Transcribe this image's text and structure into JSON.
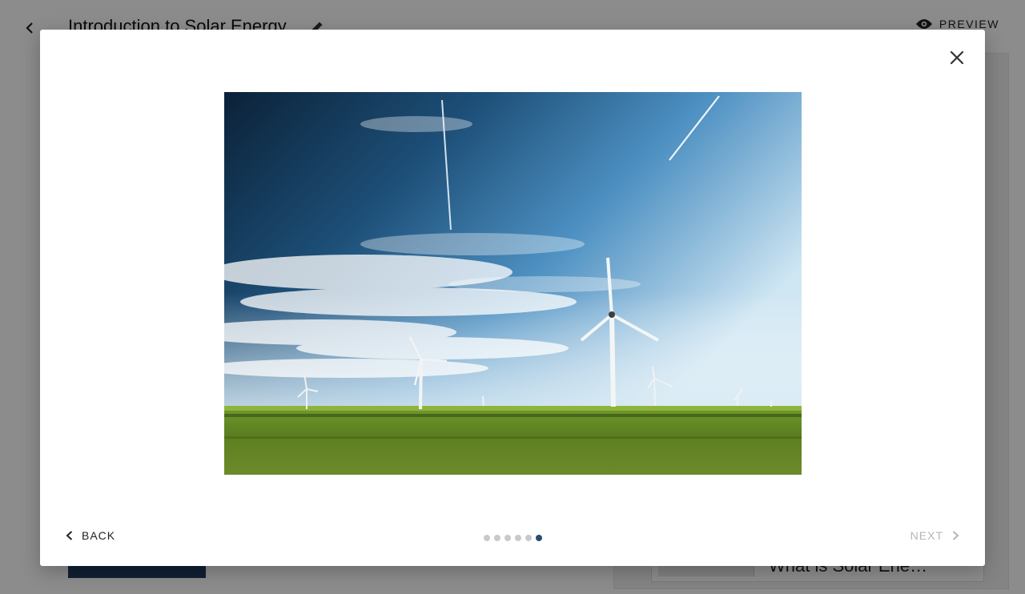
{
  "header": {
    "title": "Introduction to Solar Energy",
    "preview_label": "PREVIEW"
  },
  "background": {
    "lesson_card_title": "What is Solar Ene…"
  },
  "modal": {
    "back_label": "BACK",
    "next_label": "NEXT",
    "pagination": {
      "total": 6,
      "current": 6
    },
    "colors": {
      "active_dot": "#2b4c73",
      "inactive_dot": "#c9c9c9",
      "disabled_text": "#b5b5b5"
    }
  },
  "icons": {
    "close": "close-icon",
    "back": "chevron-left-icon",
    "next": "chevron-right-icon",
    "edit": "pencil-icon",
    "preview": "eye-icon"
  }
}
